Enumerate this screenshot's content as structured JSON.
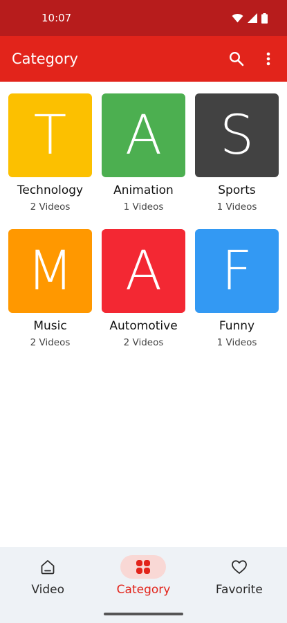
{
  "status_bar": {
    "time": "10:07"
  },
  "app_bar": {
    "title": "Category"
  },
  "categories": [
    {
      "letter": "T",
      "name": "Technology",
      "count": "2 Videos",
      "color": "#fcc000"
    },
    {
      "letter": "A",
      "name": "Animation",
      "count": "1 Videos",
      "color": "#4caf50"
    },
    {
      "letter": "S",
      "name": "Sports",
      "count": "1 Videos",
      "color": "#424242"
    },
    {
      "letter": "M",
      "name": "Music",
      "count": "2 Videos",
      "color": "#ff9800"
    },
    {
      "letter": "A",
      "name": "Automotive",
      "count": "2 Videos",
      "color": "#f32833"
    },
    {
      "letter": "F",
      "name": "Funny",
      "count": "1 Videos",
      "color": "#3399f3"
    }
  ],
  "bottom_nav": {
    "items": [
      {
        "label": "Video",
        "icon": "home-icon"
      },
      {
        "label": "Category",
        "icon": "category-grid-icon",
        "active": true
      },
      {
        "label": "Favorite",
        "icon": "heart-icon"
      }
    ]
  },
  "colors": {
    "primary": "#e2241b",
    "status_bar": "#b71c1c"
  }
}
